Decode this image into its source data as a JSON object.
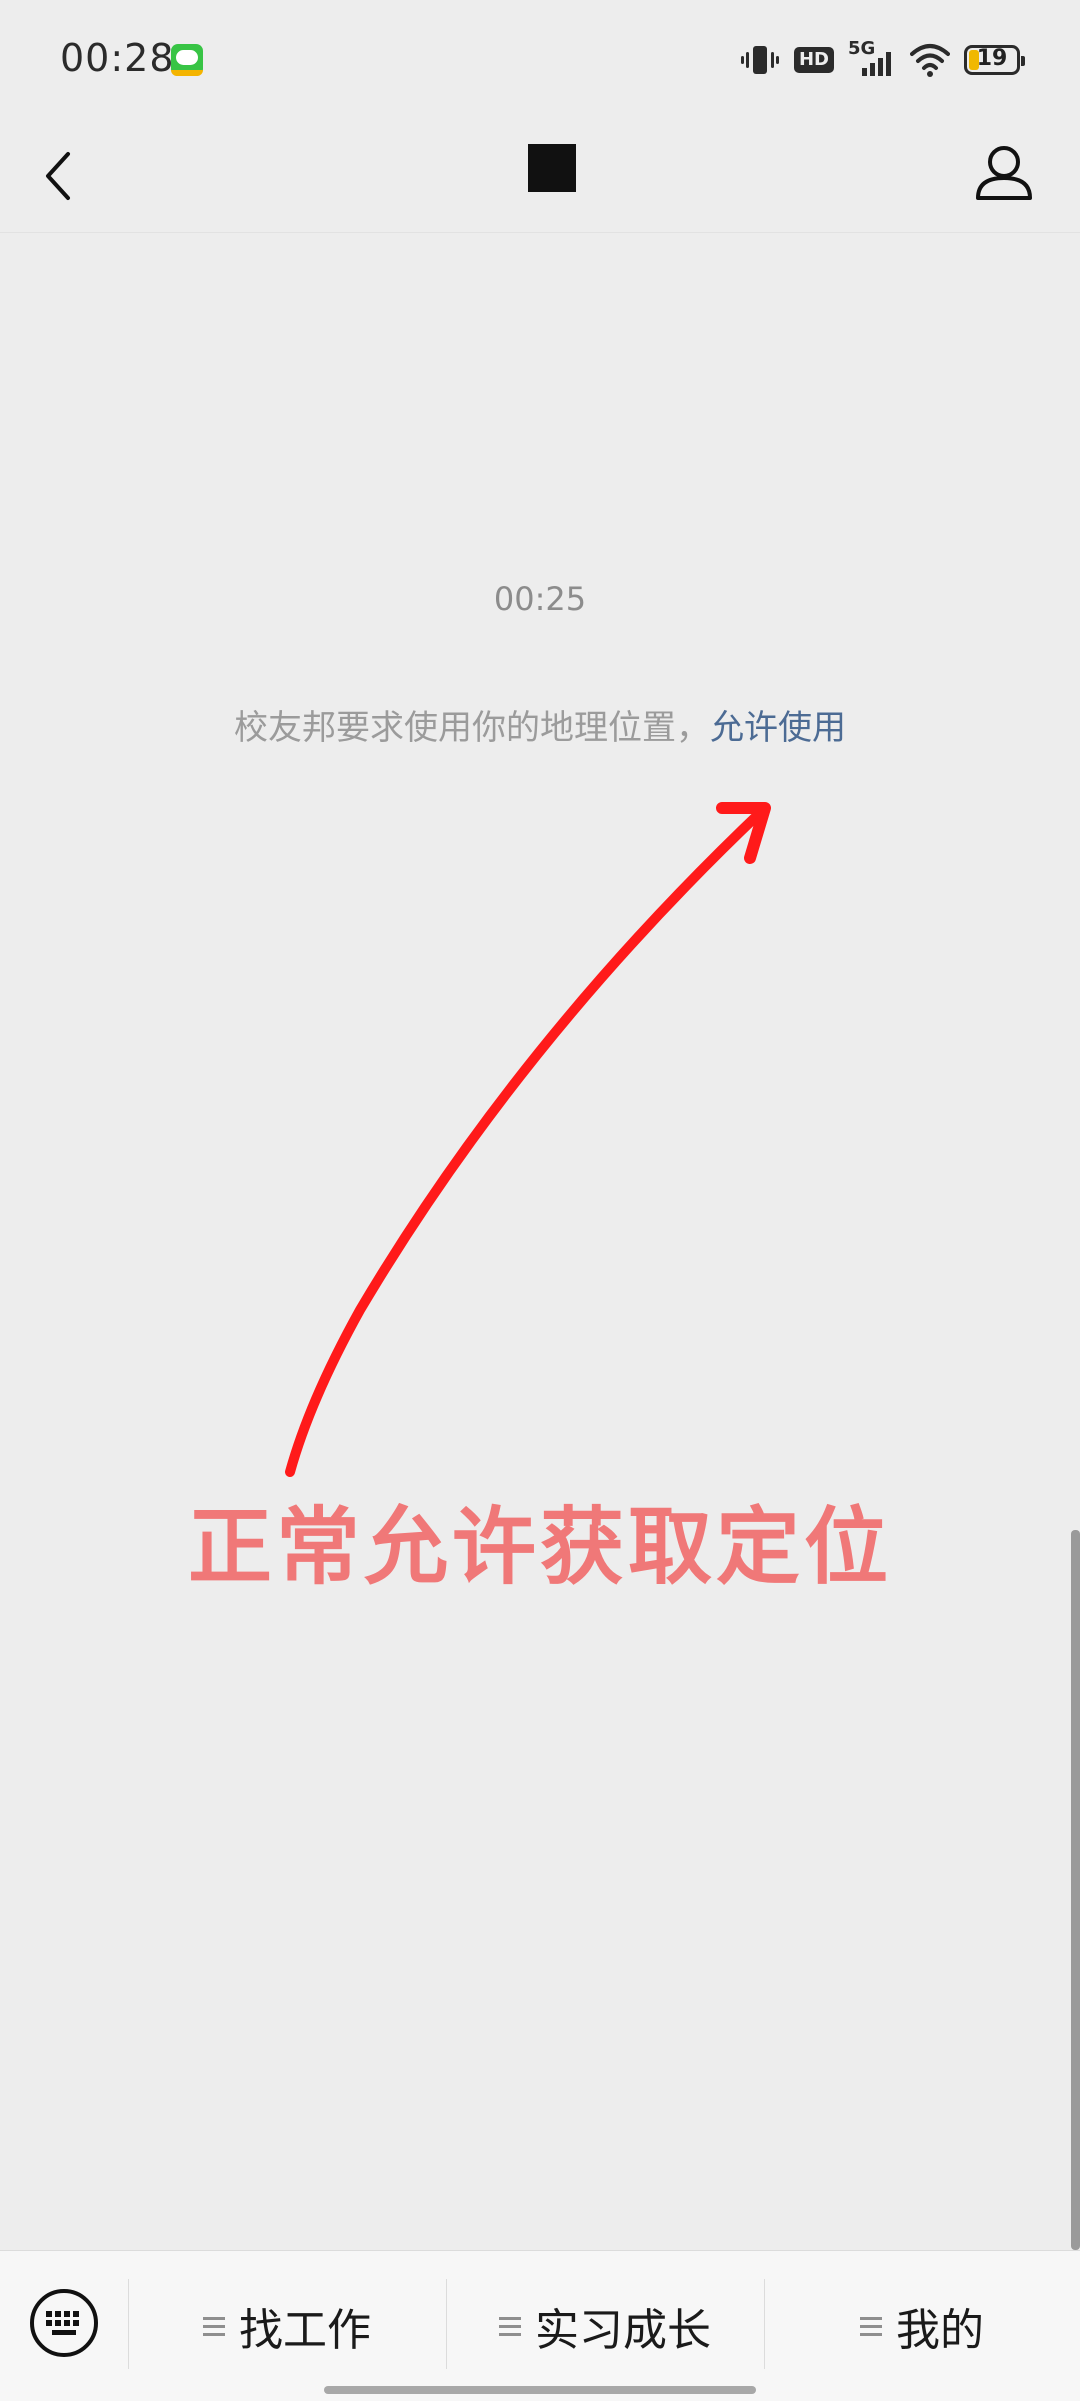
{
  "status_bar": {
    "time": "00:28",
    "battery_level": "19",
    "network_label": "5G",
    "hd_label": "HD"
  },
  "nav": {
    "back_icon": "chevron-left-icon",
    "profile_icon": "person-outline-icon"
  },
  "chat": {
    "timestamp": "00:25",
    "system_message": "校友邦要求使用你的地理位置，",
    "allow_link": "允许使用"
  },
  "annotation": {
    "text": "正常允许获取定位",
    "color": "#f07878",
    "arrow_color": "#ff1a1a"
  },
  "bottom_menu": {
    "items": [
      {
        "label": "找工作"
      },
      {
        "label": "实习成长"
      },
      {
        "label": "我的"
      }
    ]
  }
}
